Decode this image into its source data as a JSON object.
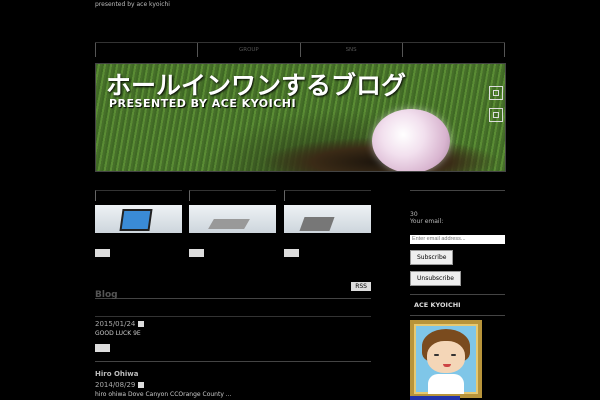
{
  "site": {
    "tagline": "presented by ace kyoichi",
    "banner_title": "ホールインワンするブログ",
    "banner_subtitle": "PRESENTED BY ACE KYOICHI"
  },
  "nav": {
    "items": [
      "",
      "GROUP",
      "SNS",
      ""
    ]
  },
  "blog": {
    "heading": "Blog",
    "rss_label": "RSS",
    "posts": [
      {
        "date": "2015/01/24",
        "excerpt": "GOOD LUCK 9E"
      },
      {
        "title": "Hiro Ohiwa",
        "date": "2014/08/29",
        "excerpt": "hiro ohiwa  Dove Canyon CCOrange County ..."
      }
    ]
  },
  "sidebar": {
    "count": "30",
    "email_label": "Your email:",
    "email_placeholder": "Enter email address...",
    "subscribe_label": "Subscribe",
    "unsubscribe_label": "Unsubscribe",
    "profile_heading": "ACE KYOICHI"
  }
}
